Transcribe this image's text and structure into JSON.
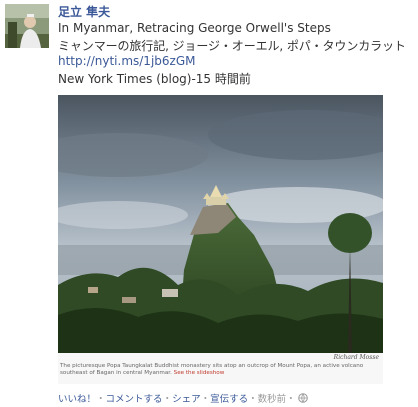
{
  "post": {
    "author_name": "足立 隼夫",
    "title": "In Myanmar, Retracing George Orwell's Steps",
    "title_jp": "ミャンマーの旅行記, ジョージ・オーエル, ポパ・タウンカラット",
    "link": "http://nyti.ms/1jb6zGM",
    "source": "New York Times (blog)-15 時間前"
  },
  "photo": {
    "credit": "Richard Mosse",
    "caption": "The picturesque Popa Taungkalat Buddhist monastery sits atop an outcrop of Mount Popa, an active volcano southeast of Bagan in central Myanmar.",
    "slideshow_link": "See the slideshow"
  },
  "actions": {
    "like": "いいね！",
    "comment": "コメントする",
    "share": "シェア",
    "sep": "・",
    "proclaim": "宣伝する",
    "time": "数秒前",
    "privacy_icon": "globe-icon"
  },
  "colors": {
    "link": "#3b5998",
    "text": "#333333",
    "meta": "#999999"
  }
}
